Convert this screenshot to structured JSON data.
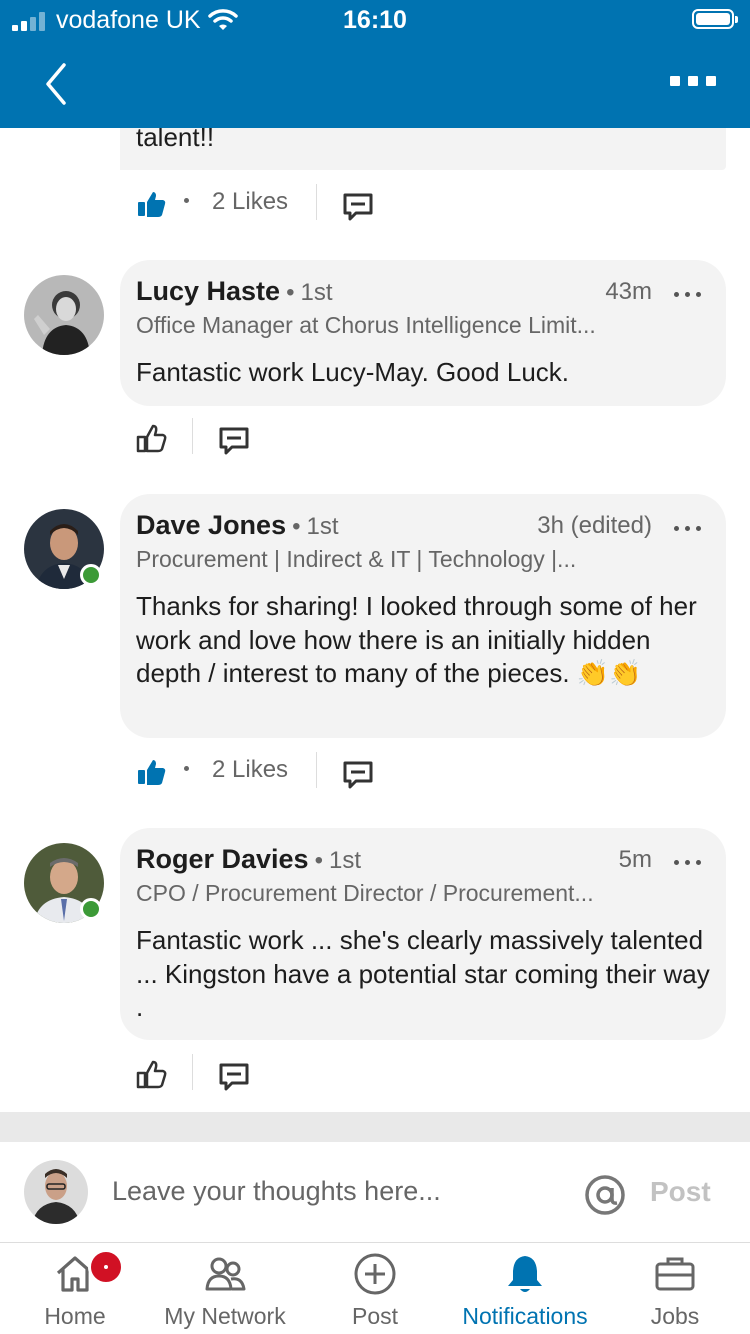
{
  "status": {
    "carrier": "vodafone UK",
    "time": "16:10"
  },
  "top_snippet": {
    "text": "talent!!"
  },
  "first_actions": {
    "likes": "2 Likes"
  },
  "comments": [
    {
      "name": "Lucy Haste",
      "degree": "1st",
      "time": "43m",
      "headline": "Office Manager at Chorus Intelligence Limit...",
      "text": "Fantastic work Lucy-May. Good Luck.",
      "likes": ""
    },
    {
      "name": "Dave Jones",
      "degree": "1st",
      "time": "3h (edited)",
      "headline": "Procurement | Indirect & IT | Technology |...",
      "text": "Thanks for sharing! I looked through some of her work and love how there is an initially hidden depth / interest to many of the pieces. 👏👏",
      "likes": "2 Likes"
    },
    {
      "name": "Roger Davies",
      "degree": "1st",
      "time": "5m",
      "headline": "CPO / Procurement Director / Procurement...",
      "text": "Fantastic work ... she's clearly massively talented ... Kingston have a potential star coming their way .",
      "likes": ""
    }
  ],
  "composer": {
    "placeholder": "Leave your thoughts here...",
    "post_label": "Post"
  },
  "tabs": [
    {
      "label": "Home",
      "icon": "home-icon"
    },
    {
      "label": "My Network",
      "icon": "network-icon"
    },
    {
      "label": "Post",
      "icon": "plus-circle-icon"
    },
    {
      "label": "Notifications",
      "icon": "bell-icon"
    },
    {
      "label": "Jobs",
      "icon": "briefcase-icon"
    }
  ],
  "colors": {
    "brand": "#0073b1",
    "presence": "#3c9a37",
    "badge": "#d11124",
    "bubble": "#f3f3f3"
  }
}
